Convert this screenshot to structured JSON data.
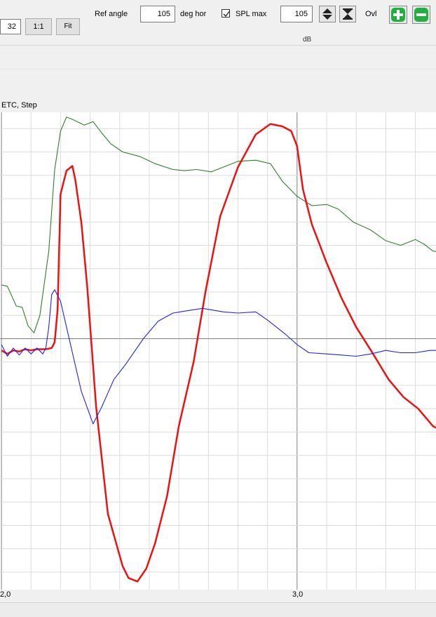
{
  "toolbar": {
    "zoom_value": "32",
    "one_to_one_label": "1:1",
    "fit_label": "Fit",
    "ref_angle_label": "Ref angle",
    "ref_angle_value": "105",
    "deg_hor_label": "deg hor",
    "spl_max_label": "SPL max",
    "spl_max_checked": true,
    "spl_max_value": "105",
    "ovl_label": "Ovl"
  },
  "header": {
    "db_label": "dB"
  },
  "plot": {
    "title": "ETC, Step"
  },
  "colors": {
    "green": "#2e7d2e",
    "red": "#ee1111",
    "blue": "#2222ee",
    "accent_green": "#20b040",
    "grid": "#dcdcdc",
    "axis": "#808080"
  },
  "chart_data": {
    "type": "line",
    "title": "ETC, Step",
    "xlabel": "",
    "ylabel": "",
    "x_tick_labels": [
      "2,0",
      "3,0"
    ],
    "grid": true,
    "series": [
      {
        "color": "#2e7d2e",
        "x": [
          2.0,
          2.02,
          2.05,
          2.07,
          2.09,
          2.11,
          2.13,
          2.16,
          2.18,
          2.2,
          2.22,
          2.24,
          2.28,
          2.31,
          2.34,
          2.37,
          2.41,
          2.47,
          2.52,
          2.58,
          2.62,
          2.66,
          2.71,
          2.76,
          2.8,
          2.86,
          2.91,
          2.95,
          3.0,
          3.05,
          3.1,
          3.14,
          3.19,
          3.25,
          3.3,
          3.35,
          3.4,
          3.43,
          3.46,
          3.5
        ],
        "y": [
          -7.4,
          -7.5,
          -9.2,
          -9.3,
          -10.9,
          -11.5,
          -10.0,
          -4.5,
          2.5,
          5.8,
          7.0,
          6.8,
          6.3,
          6.6,
          5.6,
          4.7,
          4.0,
          3.6,
          3.0,
          2.5,
          2.4,
          2.5,
          2.3,
          2.8,
          3.2,
          3.3,
          3.0,
          1.5,
          0.2,
          -0.6,
          -0.5,
          -0.9,
          -2.0,
          -2.7,
          -3.6,
          -4.0,
          -3.5,
          -3.9,
          -4.5,
          -4.6
        ]
      },
      {
        "color": "#ee1111",
        "x": [
          2.0,
          2.02,
          2.04,
          2.06,
          2.08,
          2.1,
          2.12,
          2.15,
          2.17,
          2.18,
          2.19,
          2.2,
          2.22,
          2.24,
          2.25,
          2.27,
          2.29,
          2.32,
          2.36,
          2.41,
          2.43,
          2.46,
          2.49,
          2.52,
          2.56,
          2.6,
          2.65,
          2.69,
          2.74,
          2.8,
          2.86,
          2.91,
          2.95,
          2.98,
          3.0,
          3.02,
          3.05,
          3.1,
          3.15,
          3.2,
          3.25,
          3.31,
          3.36,
          3.41,
          3.46,
          3.5
        ],
        "y": [
          -13.0,
          -13.3,
          -13.0,
          -13.1,
          -12.9,
          -13.0,
          -12.9,
          -12.9,
          -12.8,
          -12.3,
          -9.5,
          0.4,
          2.4,
          2.8,
          1.6,
          -2.0,
          -7.5,
          -17.8,
          -27.0,
          -31.5,
          -32.5,
          -32.8,
          -31.7,
          -29.5,
          -25.5,
          -19.5,
          -14.0,
          -8.0,
          -1.5,
          2.7,
          5.5,
          6.4,
          6.2,
          5.8,
          4.5,
          0.8,
          -2.2,
          -5.5,
          -8.5,
          -11.0,
          -13.0,
          -15.5,
          -17.0,
          -18.0,
          -19.5,
          -20.0
        ]
      },
      {
        "color": "#2222ee",
        "x": [
          2.0,
          2.02,
          2.04,
          2.06,
          2.08,
          2.1,
          2.12,
          2.14,
          2.15,
          2.16,
          2.17,
          2.18,
          2.2,
          2.24,
          2.27,
          2.31,
          2.34,
          2.38,
          2.42,
          2.48,
          2.53,
          2.58,
          2.63,
          2.68,
          2.75,
          2.8,
          2.86,
          2.9,
          2.93,
          2.96,
          3.0,
          3.04,
          3.1,
          3.15,
          3.2,
          3.25,
          3.3,
          3.35,
          3.4,
          3.45,
          3.5
        ],
        "y": [
          -12.5,
          -13.5,
          -12.8,
          -13.4,
          -12.8,
          -13.3,
          -12.8,
          -13.3,
          -12.8,
          -11.0,
          -8.2,
          -7.8,
          -8.8,
          -13.2,
          -16.5,
          -19.3,
          -17.8,
          -15.5,
          -14.2,
          -12.0,
          -10.5,
          -9.8,
          -9.6,
          -9.4,
          -9.7,
          -9.8,
          -9.7,
          -10.4,
          -11.0,
          -11.6,
          -12.5,
          -13.2,
          -13.3,
          -13.4,
          -13.5,
          -13.3,
          -13.0,
          -13.2,
          -13.2,
          -13.0,
          -13.0
        ]
      }
    ]
  }
}
